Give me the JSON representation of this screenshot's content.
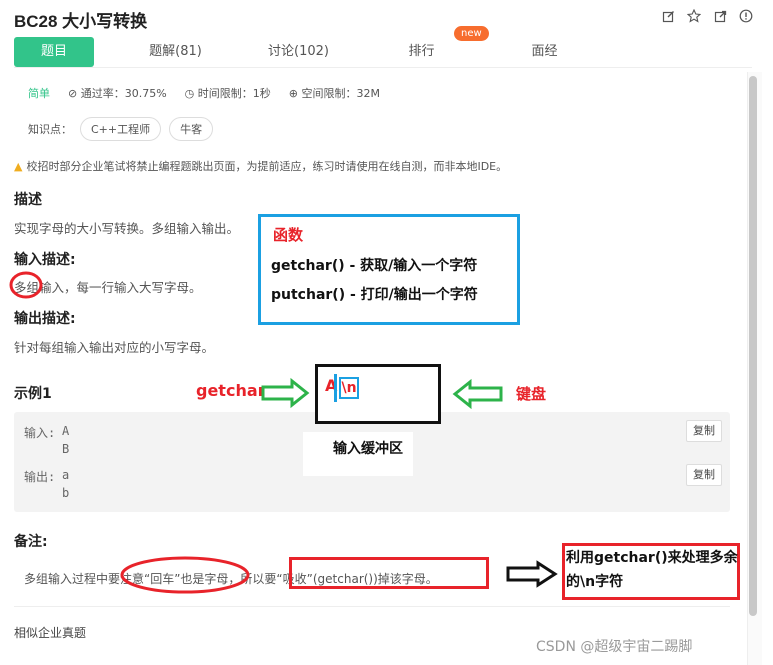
{
  "header": {
    "title": "BC28  大小写转换",
    "icons": [
      "edit-icon",
      "star-icon",
      "share-icon",
      "alert-icon"
    ]
  },
  "tabs": [
    {
      "label": "题目",
      "active": true
    },
    {
      "label": "题解(81)"
    },
    {
      "label": "讨论(102)"
    },
    {
      "label": "排行"
    },
    {
      "label": "面经"
    }
  ],
  "new_badge": "new",
  "meta": {
    "difficulty": "简单",
    "pass_rate": "通过率：30.75%",
    "time_limit": "时间限制：1秒",
    "space_limit": "空间限制：32M"
  },
  "knowledge": {
    "label": "知识点：",
    "tags": [
      "C++工程师",
      "牛客"
    ]
  },
  "warning": "校招时部分企业笔试将禁止编程题跳出页面，为提前适应，练习时请使用在线自测，而非本地IDE。",
  "sections": {
    "desc_title": "描述",
    "desc_text": "实现字母的大小写转换。多组输入输出。",
    "input_title": "输入描述:",
    "input_text": "多组输入，每一行输入大写字母。",
    "output_title": "输出描述:",
    "output_text": "针对每组输入输出对应的小写字母。",
    "example_title": "示例1",
    "example": {
      "input_label": "输入:",
      "input_lines": [
        "A",
        "B"
      ],
      "output_label": "输出:",
      "output_lines": [
        "a",
        "b"
      ],
      "copy_label": "复制"
    },
    "note_title": "备注:",
    "note_text": "多组输入过程中要注意“回车”也是字母，所以要“吸收”(getchar())掉该字母。",
    "similar": "相似企业真题"
  },
  "annotations": {
    "func_title": "函数",
    "func_line1": "getchar() - 获取/输入一个字符",
    "func_line2": "putchar() - 打印/输出一个字符",
    "getchar_label": "getchar",
    "keyboard_label": "键盘",
    "buffer_a": "A",
    "buffer_n": "\\n",
    "buffer_label": "输入缓冲区",
    "note_box": "利用getchar()来处理多余的\\n字符"
  },
  "watermark": "CSDN @超级宇宙二踢脚",
  "colors": {
    "accent_green": "#32c48a",
    "badge_orange": "#f76d2e",
    "ann_red": "#e8232a",
    "ann_blue": "#1ba0e2",
    "ann_green": "#2db34a"
  }
}
